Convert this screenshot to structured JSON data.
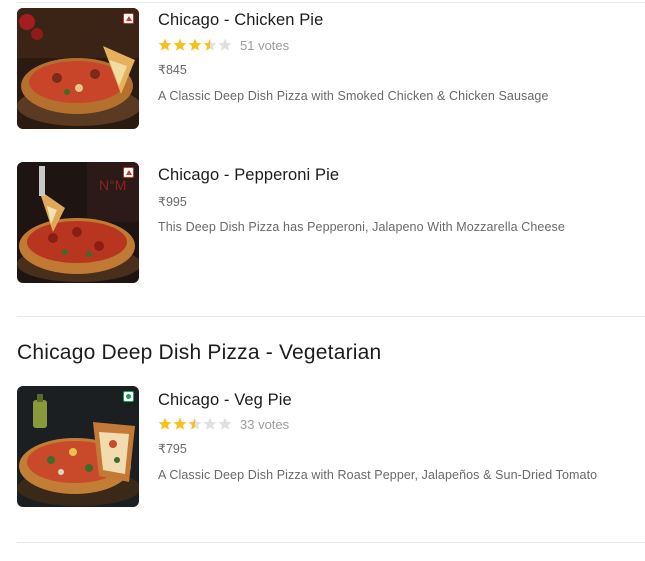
{
  "items": [
    {
      "name": "Chicago - Chicken Pie",
      "type": "non-veg",
      "rating": 3.5,
      "votes": "51 votes",
      "price": "₹845",
      "description": "A Classic Deep Dish Pizza with Smoked Chicken & Chicken Sausage"
    },
    {
      "name": "Chicago - Pepperoni Pie",
      "type": "non-veg",
      "price": "₹995",
      "description": "This Deep Dish Pizza has Pepperoni, Jalapeno With Mozzarella Cheese"
    },
    {
      "name": "Chicago - Veg Pie",
      "type": "veg",
      "rating": 2.5,
      "votes": "33 votes",
      "price": "₹795",
      "description": "A Classic Deep Dish Pizza with Roast Pepper, Jalapeños & Sun-Dried Tomato"
    }
  ],
  "section": {
    "title": "Chicago Deep Dish Pizza - Vegetarian"
  },
  "colors": {
    "star_filled": "#f3c21f",
    "star_empty": "#e0e0e0",
    "non_veg_marker": "#c0392b",
    "veg_marker": "#1f9d55"
  }
}
